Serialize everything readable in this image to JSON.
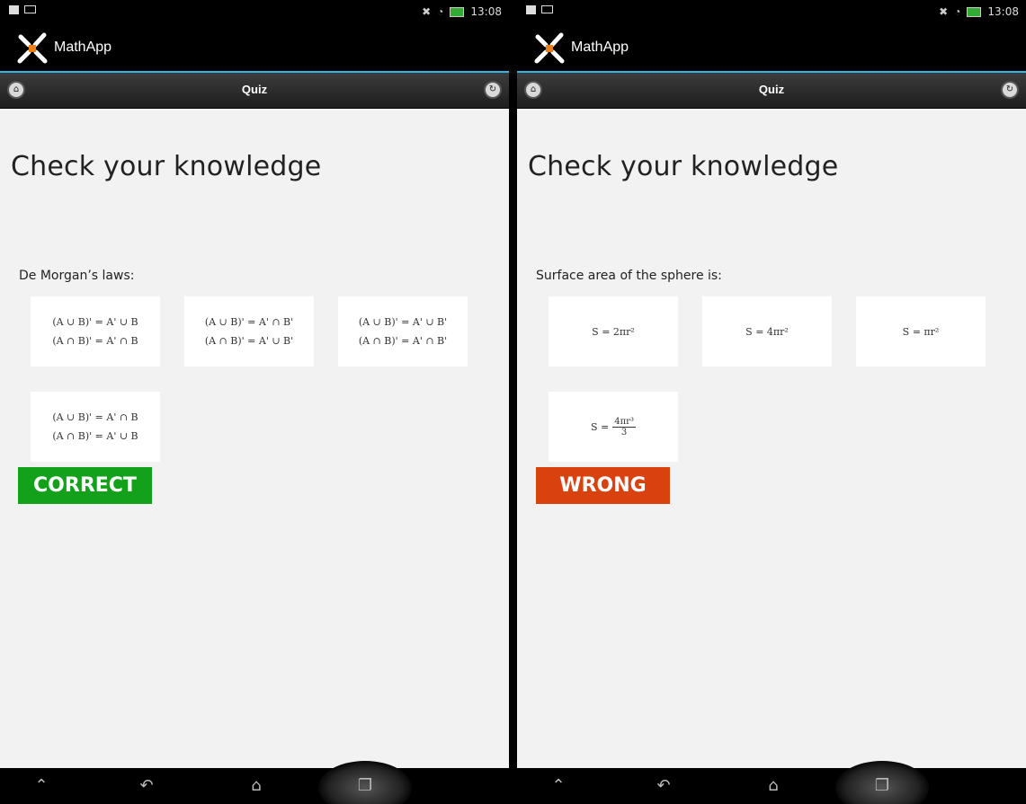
{
  "status_bar": {
    "time": "13:08"
  },
  "app": {
    "title": "MathApp"
  },
  "toolbar": {
    "title": "Quiz"
  },
  "page": {
    "heading": "Check your knowledge"
  },
  "left_quiz": {
    "question": "De Morgan’s laws:",
    "options": [
      {
        "line1": "(A ∪ B)' = A' ∪ B",
        "line2": "(A ∩ B)' = A' ∩ B"
      },
      {
        "line1": "(A ∪ B)' = A' ∩ B'",
        "line2": "(A ∩ B)' = A' ∪ B'"
      },
      {
        "line1": "(A ∪ B)' = A' ∪ B'",
        "line2": "(A ∩ B)' = A' ∩ B'"
      },
      {
        "line1": "(A ∪ B)' = A' ∩ B",
        "line2": "(A ∩ B)' = A' ∪ B"
      }
    ],
    "result": "CORRECT",
    "result_color": "#13a11b"
  },
  "right_quiz": {
    "question": "Surface area of the sphere is:",
    "options": [
      {
        "line1": "S = 2πr²"
      },
      {
        "line1": "S = 4πr²"
      },
      {
        "line1": "S = πr²"
      },
      {
        "numerator": "4πr³",
        "denominator": "3",
        "prefix": "S ="
      }
    ],
    "result": "WRONG",
    "result_color": "#d9410e"
  },
  "icons": {
    "app_logo": "mathapp-logo-icon",
    "home": "home-icon",
    "refresh": "refresh-icon",
    "nav_up": "chevron-up-icon",
    "nav_back": "back-arrow-icon",
    "nav_home": "home-outline-icon",
    "nav_recent": "recent-apps-icon"
  },
  "colors": {
    "accent": "#31b6e7",
    "correct": "#13a11b",
    "wrong": "#d9410e"
  }
}
